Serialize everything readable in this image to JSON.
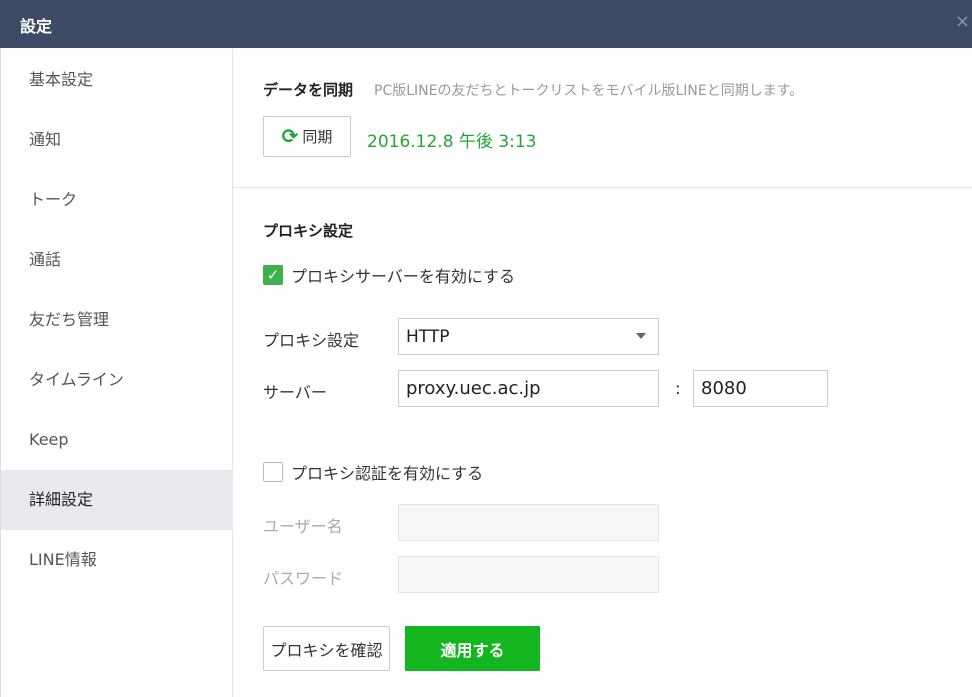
{
  "window": {
    "title": "設定",
    "close_glyph": "×"
  },
  "sidebar": {
    "items": [
      {
        "label": "基本設定"
      },
      {
        "label": "通知"
      },
      {
        "label": "トーク"
      },
      {
        "label": "通話"
      },
      {
        "label": "友だち管理"
      },
      {
        "label": "タイムライン"
      },
      {
        "label": "Keep"
      },
      {
        "label": "詳細設定",
        "active": true
      },
      {
        "label": "LINE情報"
      }
    ]
  },
  "sync": {
    "heading": "データを同期",
    "description": "PC版LINEの友だちとトークリストをモバイル版LINEと同期します。",
    "button_label": "同期",
    "button_icon": "refresh-icon",
    "last_synced": "2016.12.8 午後 3:13"
  },
  "proxy": {
    "heading": "プロキシ設定",
    "enable_label": "プロキシサーバーを有効にする",
    "enable_checked": true,
    "type_label": "プロキシ設定",
    "type_value": "HTTP",
    "server_label": "サーバー",
    "server_value": "proxy.uec.ac.jp",
    "port_separator": ":",
    "port_value": "8080",
    "auth_label": "プロキシ認証を有効にする",
    "auth_checked": false,
    "username_label": "ユーザー名",
    "username_value": "",
    "password_label": "パスワード",
    "password_value": "",
    "confirm_button": "プロキシを確認",
    "apply_button": "適用する"
  },
  "colors": {
    "titlebar": "#3e4b64",
    "accent_green": "#13b61e",
    "sync_time": "#25a53a",
    "sidebar_active": "#e8eaf0"
  }
}
